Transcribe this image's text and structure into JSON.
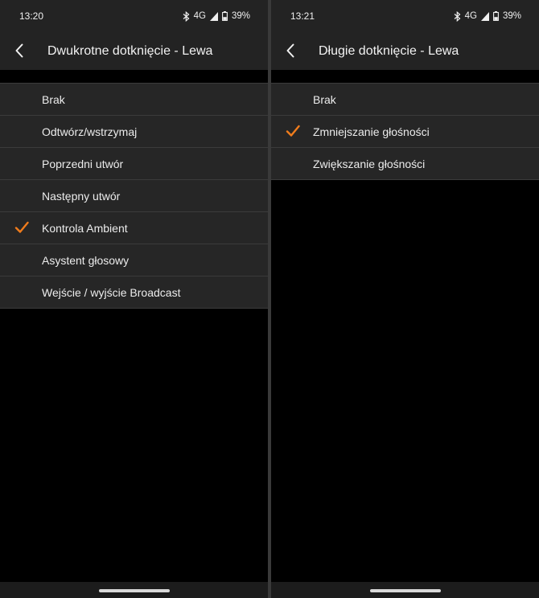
{
  "accent_color": "#f07c1c",
  "left": {
    "status": {
      "time": "13:20",
      "network": "4G",
      "battery": "39%"
    },
    "title": "Dwukrotne dotknięcie - Lewa",
    "items": [
      {
        "label": "Brak",
        "selected": false
      },
      {
        "label": "Odtwórz/wstrzymaj",
        "selected": false
      },
      {
        "label": "Poprzedni utwór",
        "selected": false
      },
      {
        "label": "Następny utwór",
        "selected": false
      },
      {
        "label": "Kontrola Ambient",
        "selected": true
      },
      {
        "label": "Asystent głosowy",
        "selected": false
      },
      {
        "label": "Wejście / wyjście Broadcast",
        "selected": false
      }
    ]
  },
  "right": {
    "status": {
      "time": "13:21",
      "network": "4G",
      "battery": "39%"
    },
    "title": "Długie dotknięcie - Lewa",
    "items": [
      {
        "label": "Brak",
        "selected": false
      },
      {
        "label": "Zmniejszanie głośności",
        "selected": true
      },
      {
        "label": "Zwiększanie głośności",
        "selected": false
      }
    ]
  },
  "icons": {
    "back": "chevron-left-icon",
    "bluetooth": "bluetooth-icon",
    "signal": "signal-icon",
    "battery": "battery-icon",
    "check": "check-icon"
  }
}
